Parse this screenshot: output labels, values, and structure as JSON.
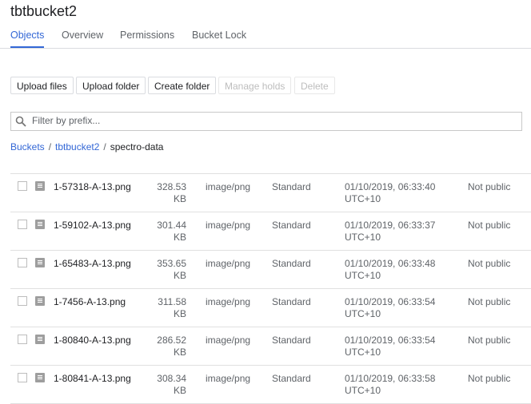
{
  "title": "tbtbucket2",
  "tabs": [
    {
      "label": "Objects",
      "active": true
    },
    {
      "label": "Overview"
    },
    {
      "label": "Permissions"
    },
    {
      "label": "Bucket Lock"
    }
  ],
  "toolbar": {
    "upload_files": "Upload files",
    "upload_folder": "Upload folder",
    "create_folder": "Create folder",
    "manage_holds": "Manage holds",
    "delete": "Delete"
  },
  "filter": {
    "placeholder": "Filter by prefix...",
    "value": ""
  },
  "breadcrumb": {
    "root": "Buckets",
    "bucket": "tbtbucket2",
    "folder": "spectro-data"
  },
  "accent": "#3367d6",
  "rows": [
    {
      "name": "1-57318-A-13.png",
      "size": "328.53",
      "unit": "KB",
      "type": "image/png",
      "class": "Standard",
      "date": "01/10/2019, 06:33:40",
      "tz": "UTC+10",
      "public": "Not public"
    },
    {
      "name": "1-59102-A-13.png",
      "size": "301.44",
      "unit": "KB",
      "type": "image/png",
      "class": "Standard",
      "date": "01/10/2019, 06:33:37",
      "tz": "UTC+10",
      "public": "Not public"
    },
    {
      "name": "1-65483-A-13.png",
      "size": "353.65",
      "unit": "KB",
      "type": "image/png",
      "class": "Standard",
      "date": "01/10/2019, 06:33:48",
      "tz": "UTC+10",
      "public": "Not public"
    },
    {
      "name": "1-7456-A-13.png",
      "size": "311.58",
      "unit": "KB",
      "type": "image/png",
      "class": "Standard",
      "date": "01/10/2019, 06:33:54",
      "tz": "UTC+10",
      "public": "Not public"
    },
    {
      "name": "1-80840-A-13.png",
      "size": "286.52",
      "unit": "KB",
      "type": "image/png",
      "class": "Standard",
      "date": "01/10/2019, 06:33:54",
      "tz": "UTC+10",
      "public": "Not public"
    },
    {
      "name": "1-80841-A-13.png",
      "size": "308.34",
      "unit": "KB",
      "type": "image/png",
      "class": "Standard",
      "date": "01/10/2019, 06:33:58",
      "tz": "UTC+10",
      "public": "Not public"
    }
  ]
}
